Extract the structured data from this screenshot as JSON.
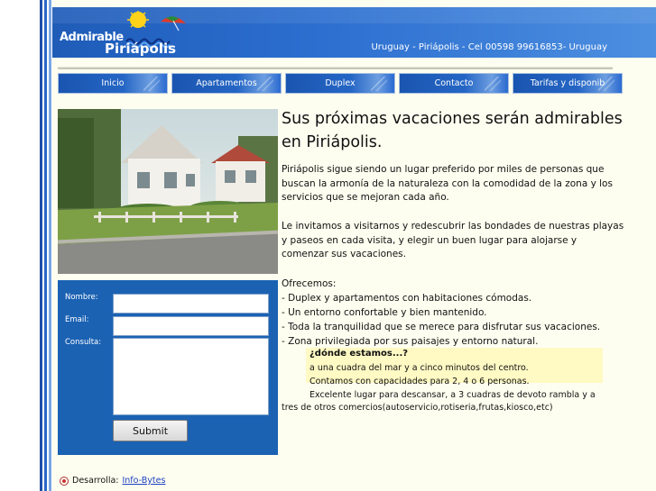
{
  "header": {
    "logo_top": "Admirable",
    "logo_bottom": "Piriápolis",
    "info": "Uruguay - Piriápolis - Cel 00598 99616853- Uruguay"
  },
  "nav": {
    "items": [
      {
        "label": "Inicio"
      },
      {
        "label": "Apartamentos"
      },
      {
        "label": "Duplex"
      },
      {
        "label": "Contacto"
      },
      {
        "label": "Tarifas y disponib"
      }
    ]
  },
  "main": {
    "headline": "Sus próximas vacaciones serán admirables en Piriápolis.",
    "para1": "Piriápolis sigue siendo un lugar preferido por miles de personas que buscan la armonía de la naturaleza con la comodidad de la zona y los servicios que se mejoran cada año.",
    "para2": "Le invitamos a visitarnos y redescubrir las bondades de nuestras playas y paseos en cada visita, y elegir un buen lugar para alojarse y comenzar sus vacaciones.",
    "offer_title": "Ofrecemos:",
    "offer_items": [
      "- Duplex y apartamentos con habitaciones cómodas.",
      "- Un entorno confortable y bien mantenido.",
      "- Toda la tranquilidad que se merece para disfrutar sus vacaciones.",
      "- Zona privilegiada por sus paisajes y entorno natural."
    ],
    "where_title": "¿dónde estamos...?",
    "where_lines": [
      "a una cuadra del mar y a cinco minutos del centro.",
      "Contamos con capacidades para 2, 4 o 6 personas.",
      "Excelente lugar para descansar, a 3 cuadras de devoto rambla y a",
      "tres de otros comercios(autoservicio,rotiseria,frutas,kiosco,etc)"
    ]
  },
  "form": {
    "name_label": "Nombre:",
    "email_label": "Email:",
    "query_label": "Consulta:",
    "name_value": "",
    "email_value": "",
    "query_value": "",
    "submit_label": "Submit"
  },
  "footer": {
    "label": "Desarrolla:",
    "link": "Info-Bytes"
  },
  "colors": {
    "header_blue": "#2c6fd0",
    "form_blue": "#1b62b3",
    "highlight_yellow": "#fff9c4",
    "page_bg": "#fefef0"
  }
}
